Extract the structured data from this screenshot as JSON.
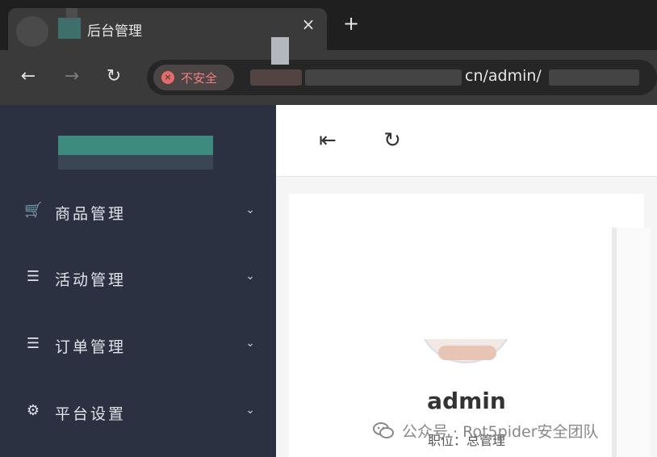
{
  "browser": {
    "tab_title": "后台管理",
    "tab_close": "×",
    "new_tab": "+",
    "nav": {
      "back": "←",
      "forward": "→",
      "reload": "↻"
    },
    "security_label": "不安全",
    "url_visible": "cn/admin/"
  },
  "sidebar": {
    "items": [
      {
        "label": "商品管理",
        "icon": "cart-icon",
        "glyph": "🛒"
      },
      {
        "label": "活动管理",
        "icon": "list-icon",
        "glyph": "☰"
      },
      {
        "label": "订单管理",
        "icon": "list-icon",
        "glyph": "☰"
      },
      {
        "label": "平台设置",
        "icon": "gears-icon",
        "glyph": "⚙"
      }
    ],
    "chevron": "⌄"
  },
  "toolbar": {
    "collapse_glyph": "⇤",
    "refresh_glyph": "↻"
  },
  "profile": {
    "username": "admin",
    "position": "职位：总管理"
  },
  "watermark": {
    "text": "公众号 · Rot5pider安全团队"
  },
  "colors": {
    "sidebar_bg": "#2b3140",
    "chrome_dark": "#1f1f1f",
    "chrome_mid": "#3a3a3a",
    "insecure_red": "#f08080",
    "logo_teal": "#3d8a7e"
  }
}
